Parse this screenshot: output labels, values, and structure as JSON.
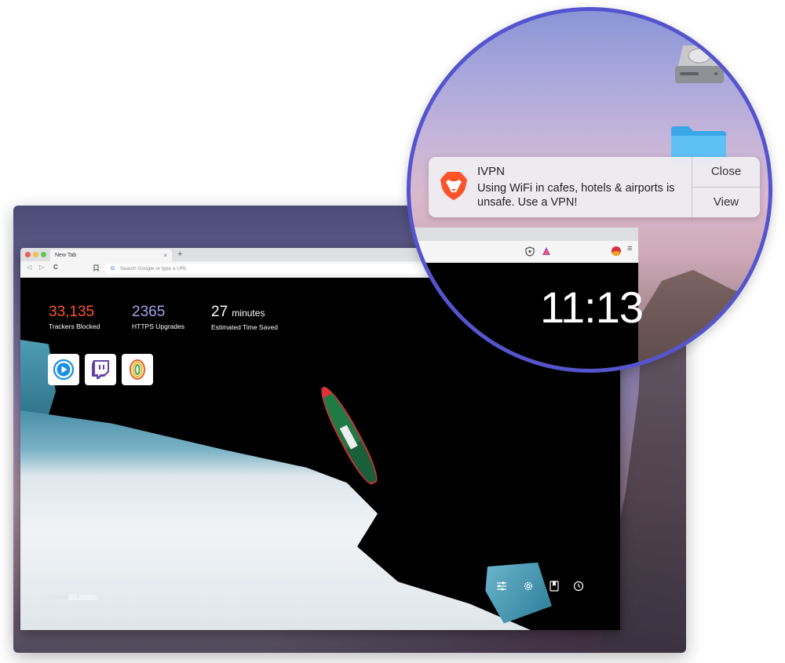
{
  "browser": {
    "tab_title": "New Tab",
    "tab_close": "×",
    "new_tab": "+",
    "back": "◁",
    "forward": "▷",
    "reload": "C",
    "url_placeholder": "Search Google or type a URL",
    "search_engine_glyph": "G"
  },
  "ntp": {
    "stats": [
      {
        "value": "33,135",
        "unit": "",
        "label": "Trackers Blocked",
        "color": "#fb542b"
      },
      {
        "value": "2365",
        "unit": "",
        "label": "HTTPS Upgrades",
        "color": "#a0a5eb"
      },
      {
        "value": "27",
        "unit": "minutes",
        "label": "Estimated Time Saved",
        "color": "#ffffff"
      }
    ],
    "tiles": [
      "play-icon",
      "twitch-icon",
      "brand-logo-icon"
    ],
    "photo_credit_prefix": "Photo by",
    "photo_credit_name": "Ilmir Sadykov",
    "bottom_icons": [
      "sliders-icon",
      "gear-icon",
      "bookmark-icon",
      "history-icon"
    ],
    "clock": "11:13"
  },
  "notification": {
    "app": "IVPN",
    "message": "Using WiFi in cafes, hotels & airports is unsafe. Use a VPN!",
    "close_label": "Close",
    "view_label": "View"
  },
  "colors": {
    "magnifier_ring": "#5454cf",
    "brave_orange": "#fb542b"
  }
}
